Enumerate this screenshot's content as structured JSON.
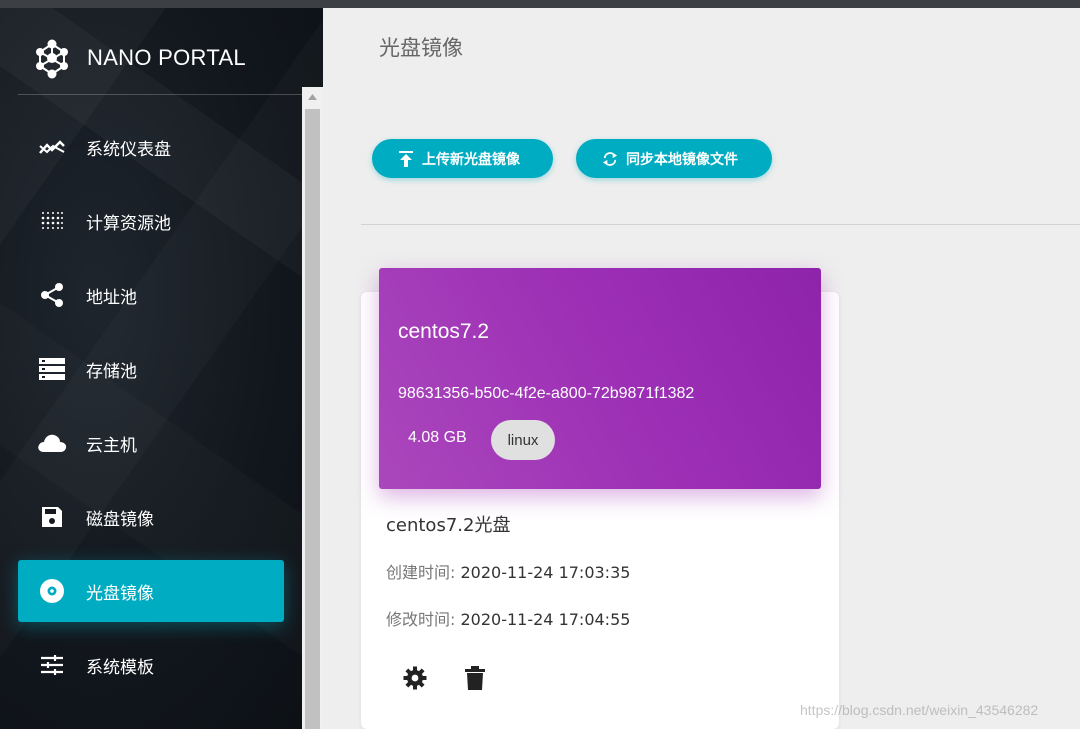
{
  "brand": {
    "title": "NANO PORTAL"
  },
  "sidebar": {
    "items": [
      {
        "label": "系统仪表盘",
        "icon": "trending-icon"
      },
      {
        "label": "计算资源池",
        "icon": "grid-dots-icon"
      },
      {
        "label": "地址池",
        "icon": "share-icon"
      },
      {
        "label": "存储池",
        "icon": "storage-icon"
      },
      {
        "label": "云主机",
        "icon": "cloud-icon"
      },
      {
        "label": "磁盘镜像",
        "icon": "save-icon"
      },
      {
        "label": "光盘镜像",
        "icon": "disc-icon",
        "active": true
      },
      {
        "label": "系统模板",
        "icon": "tune-icon"
      }
    ]
  },
  "main": {
    "title": "光盘镜像",
    "buttons": {
      "upload": "上传新光盘镜像",
      "sync": "同步本地镜像文件"
    }
  },
  "card": {
    "name": "centos7.2",
    "id": "98631356-b50c-4f2e-a800-72b9871f1382",
    "size": "4.08 GB",
    "tag": "linux",
    "title": "centos7.2光盘",
    "created_label": "创建时间:",
    "created_value": "2020-11-24 17:03:35",
    "modified_label": "修改时间:",
    "modified_value": "2020-11-24 17:04:55"
  },
  "watermark": "https://blog.csdn.net/weixin_43546282",
  "colors": {
    "accent": "#00acc1",
    "card_header": "#9c27b0",
    "sidebar_bg": "#141a20"
  }
}
